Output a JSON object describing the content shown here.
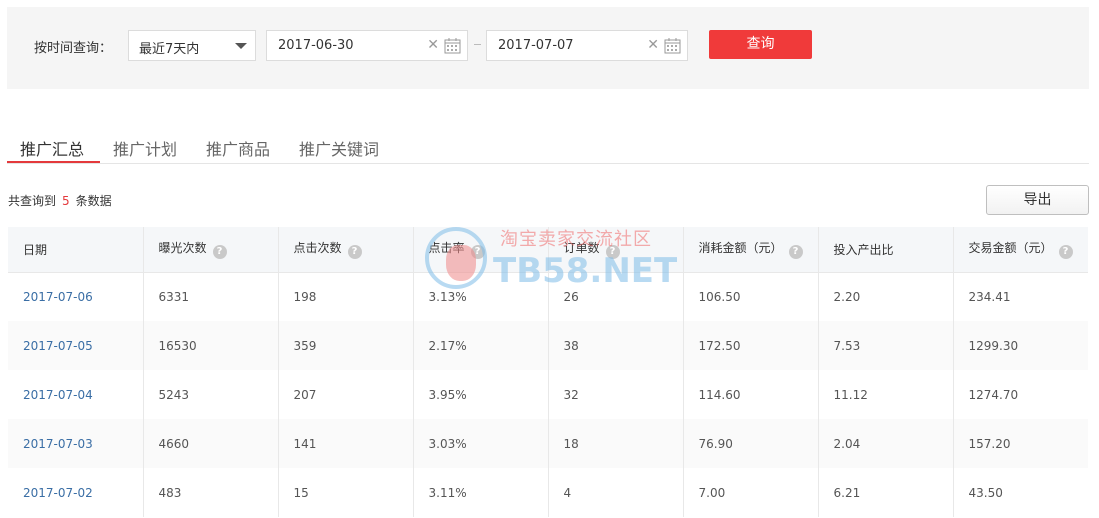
{
  "filter": {
    "label": "按时间查询：",
    "range_select": "最近7天内",
    "start_date": "2017-06-30",
    "end_date": "2017-07-07",
    "query_label": "查询"
  },
  "tabs": [
    {
      "label": "推广汇总",
      "active": true
    },
    {
      "label": "推广计划",
      "active": false
    },
    {
      "label": "推广商品",
      "active": false
    },
    {
      "label": "推广关键词",
      "active": false
    }
  ],
  "result": {
    "prefix": "共查询到",
    "count": "5",
    "suffix": "条数据",
    "export_label": "导出"
  },
  "table": {
    "headers": [
      "日期",
      "曝光次数",
      "点击次数",
      "点击率",
      "订单数",
      "消耗金额（元）",
      "投入产出比",
      "交易金额（元）"
    ],
    "rows": [
      [
        "2017-07-06",
        "6331",
        "198",
        "3.13%",
        "26",
        "106.50",
        "2.20",
        "234.41"
      ],
      [
        "2017-07-05",
        "16530",
        "359",
        "2.17%",
        "38",
        "172.50",
        "7.53",
        "1299.30"
      ],
      [
        "2017-07-04",
        "5243",
        "207",
        "3.95%",
        "32",
        "114.60",
        "11.12",
        "1274.70"
      ],
      [
        "2017-07-03",
        "4660",
        "141",
        "3.03%",
        "18",
        "76.90",
        "2.04",
        "157.20"
      ],
      [
        "2017-07-02",
        "483",
        "15",
        "3.11%",
        "4",
        "7.00",
        "6.21",
        "43.50"
      ]
    ]
  },
  "watermark": {
    "cn": "淘宝卖家交流社区",
    "en": "TB58.NET"
  },
  "colors": {
    "accent": "#f03a3a",
    "link": "#3a6ea5"
  }
}
